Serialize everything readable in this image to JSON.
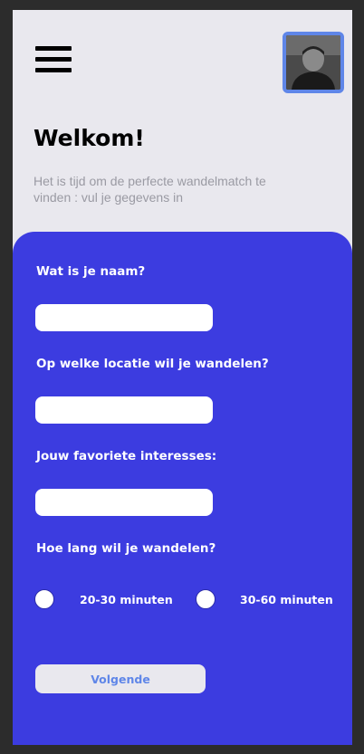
{
  "header": {
    "menu_icon": "hamburger-menu-icon",
    "avatar_icon": "user-avatar"
  },
  "welcome": {
    "title": "Welkom!",
    "subtitle": "Het is tijd om de perfecte wandelmatch te vinden : vul je gegevens in"
  },
  "form": {
    "name_label": "Wat is je naam?",
    "name_value": "",
    "location_label": "Op welke locatie wil je wandelen?",
    "location_value": "",
    "interests_label": "Jouw favoriete interesses:",
    "interests_value": "",
    "duration_label": "Hoe lang wil je wandelen?",
    "duration_options": [
      {
        "label": "20-30 minuten",
        "selected": false
      },
      {
        "label": "30-60 minuten",
        "selected": false
      }
    ],
    "next_label": "Volgende"
  },
  "colors": {
    "background": "#e9e8ee",
    "form_card": "#3c3ce0",
    "accent": "#5f86e8",
    "outer": "#2c2c2c"
  }
}
